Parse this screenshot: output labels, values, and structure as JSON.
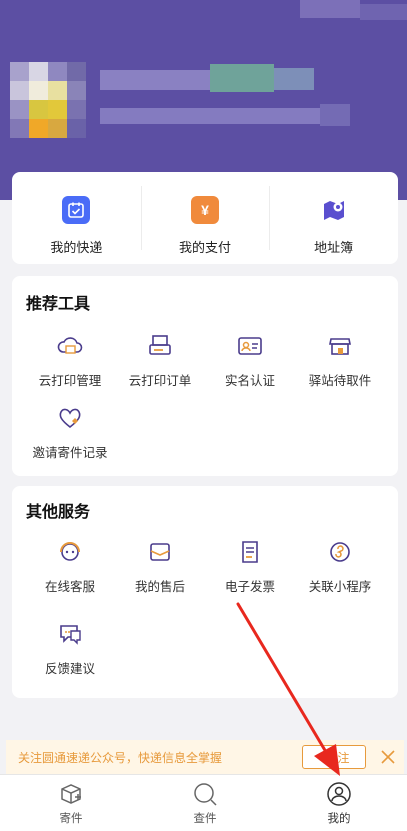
{
  "quick_actions": [
    {
      "label": "我的快递",
      "icon": "calendar-check-icon",
      "color": "#4a6cf7"
    },
    {
      "label": "我的支付",
      "icon": "wallet-yen-icon",
      "color": "#f08a3c"
    },
    {
      "label": "地址簿",
      "icon": "map-pin-icon",
      "color": "#5a4fcf"
    }
  ],
  "recommended": {
    "title": "推荐工具",
    "items": [
      {
        "label": "云打印管理",
        "icon": "cloud-print-icon"
      },
      {
        "label": "云打印订单",
        "icon": "print-order-icon"
      },
      {
        "label": "实名认证",
        "icon": "id-card-icon"
      },
      {
        "label": "驿站待取件",
        "icon": "station-store-icon"
      },
      {
        "label": "邀请寄件记录",
        "icon": "heart-invite-icon"
      }
    ]
  },
  "services": {
    "title": "其他服务",
    "items": [
      {
        "label": "在线客服",
        "icon": "customer-service-icon"
      },
      {
        "label": "我的售后",
        "icon": "after-sales-icon"
      },
      {
        "label": "电子发票",
        "icon": "e-invoice-icon"
      },
      {
        "label": "关联小程序",
        "icon": "mini-program-icon"
      },
      {
        "label": "反馈建议",
        "icon": "feedback-icon"
      }
    ]
  },
  "notice": {
    "text": "关注圆通速递公众号，快递信息全掌握",
    "follow_label": "+关注",
    "color": "#e79a3c"
  },
  "tabbar": {
    "items": [
      {
        "label": "寄件",
        "icon": "box-plus-icon"
      },
      {
        "label": "查件",
        "icon": "search-icon"
      },
      {
        "label": "我的",
        "icon": "user-icon",
        "active": true
      }
    ]
  },
  "colors": {
    "header": "#5c4fa3",
    "accent": "#e79a3c",
    "annotation_arrow": "#e8281e"
  }
}
